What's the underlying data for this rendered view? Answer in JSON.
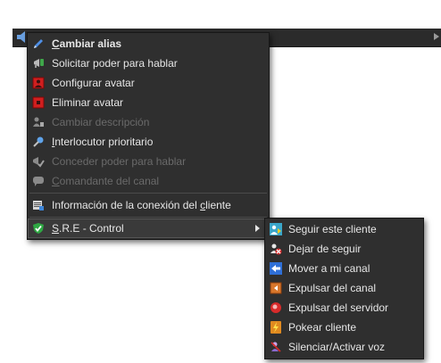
{
  "main_menu": {
    "items": [
      {
        "pre": "",
        "ul": "C",
        "post": "ambiar alias",
        "enabled": true
      },
      {
        "pre": "Solicitar poder para hablar",
        "ul": "",
        "post": "",
        "enabled": true
      },
      {
        "pre": "Configurar avatar",
        "ul": "",
        "post": "",
        "enabled": true
      },
      {
        "pre": "Eliminar avatar",
        "ul": "",
        "post": "",
        "enabled": true
      },
      {
        "pre": "Cambiar descripción",
        "ul": "",
        "post": "",
        "enabled": false
      },
      {
        "pre": "",
        "ul": "I",
        "post": "nterlocutor prioritario",
        "enabled": true
      },
      {
        "pre": "Conceder poder para hablar",
        "ul": "",
        "post": "",
        "enabled": false
      },
      {
        "pre": "",
        "ul": "C",
        "post": "omandante del canal",
        "enabled": false
      },
      {
        "pre": "Información de la conexión del ",
        "ul": "c",
        "post": "liente",
        "enabled": true
      },
      {
        "pre": "",
        "ul": "S",
        "post": ".R.E - Control",
        "enabled": true,
        "has_submenu": true
      }
    ]
  },
  "sub_menu": {
    "items": [
      {
        "label": "Seguir este cliente"
      },
      {
        "label": "Dejar de seguir"
      },
      {
        "label": "Mover a mi canal"
      },
      {
        "label": "Expulsar del canal"
      },
      {
        "label": "Expulsar del servidor"
      },
      {
        "label": "Pokear cliente"
      },
      {
        "label": "Silenciar/Activar voz"
      }
    ]
  },
  "icons": {
    "main": [
      "pencil-icon",
      "megaphone-icon",
      "avatar-icon",
      "avatar-remove-icon",
      "user-description-icon",
      "microphone-icon",
      "talk-power-icon",
      "chat-bubble-icon",
      "connection-info-icon",
      "green-shield-icon"
    ],
    "sub": [
      "follow-icon",
      "unfollow-icon",
      "move-arrow-icon",
      "kick-channel-icon",
      "kick-server-icon",
      "poke-icon",
      "mute-icon"
    ]
  },
  "colors": {
    "menu_bg": "#2f2f2f",
    "menu_text": "#e6e6e6",
    "disabled_text": "#6a6a6a",
    "hover_outline": "#565656"
  }
}
